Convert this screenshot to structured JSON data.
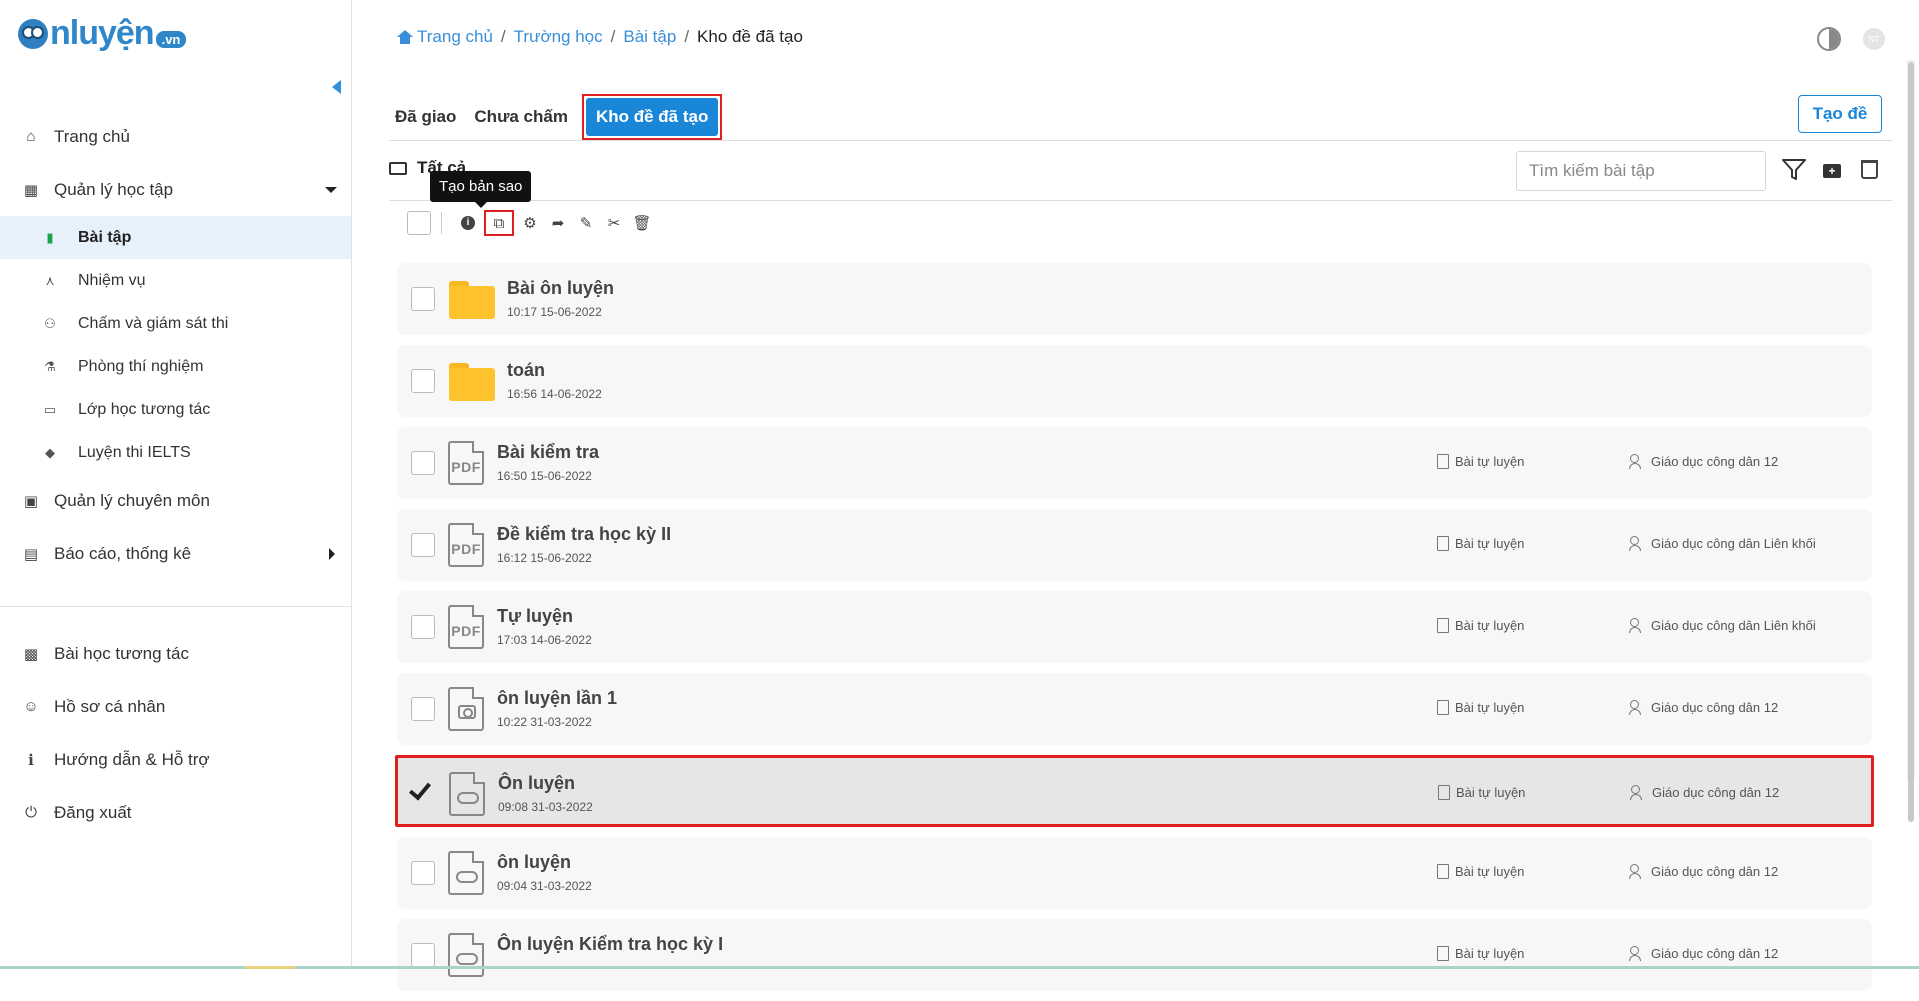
{
  "logo": {
    "text": "nluyện",
    "suffix": ".vn"
  },
  "sidebar": {
    "items": [
      {
        "label": "Trang chủ",
        "icon": "home-icon"
      },
      {
        "label": "Quản lý học tập",
        "icon": "school-icon"
      }
    ],
    "sub_items": [
      {
        "label": "Bài tập",
        "icon": "trash-bin-icon"
      },
      {
        "label": "Nhiệm vụ",
        "icon": "compass-icon"
      },
      {
        "label": "Chấm và giám sát thi",
        "icon": "people-icon"
      },
      {
        "label": "Phòng thí nghiệm",
        "icon": "flask-icon"
      },
      {
        "label": "Lớp học tương tác",
        "icon": "monitor-icon"
      },
      {
        "label": "Luyện thi IELTS",
        "icon": "graduation-icon"
      }
    ],
    "items2": [
      {
        "label": "Quản lý chuyên môn",
        "icon": "calendar-icon"
      },
      {
        "label": "Báo cáo, thống kê",
        "icon": "report-icon"
      }
    ],
    "bottom_items": [
      {
        "label": "Bài học tương tác",
        "icon": "lesson-icon"
      },
      {
        "label": "Hồ sơ cá nhân",
        "icon": "user-icon"
      },
      {
        "label": "Hướng dẫn & Hỗ trợ",
        "icon": "info-icon"
      },
      {
        "label": "Đăng xuất",
        "icon": "power-icon"
      }
    ]
  },
  "breadcrumb": {
    "home": "Trang chủ",
    "school": "Trường học",
    "exercises": "Bài tập",
    "current": "Kho đề đã tạo"
  },
  "header": {
    "avatar_initials": "NT"
  },
  "tabs": {
    "assigned": "Đã giao",
    "ungraded": "Chưa chấm",
    "created_bank": "Kho đề đã tạo"
  },
  "create_button": "Tạo đề",
  "folder_path": "Tất cả",
  "search": {
    "placeholder": "Tìm kiếm bài tập"
  },
  "tooltip": "Tạo bản sao",
  "rows": [
    {
      "kind": "folder",
      "title": "Bài ôn luyện",
      "date": "10:17 15-06-2022"
    },
    {
      "kind": "folder",
      "title": "toán",
      "date": "16:56 14-06-2022"
    },
    {
      "kind": "pdf",
      "title": "Bài kiểm tra",
      "date": "16:50 15-06-2022",
      "type": "Bài tự luyện",
      "subject": "Giáo dục công dân 12"
    },
    {
      "kind": "pdf",
      "title": "Đề kiểm tra học kỳ II",
      "date": "16:12 15-06-2022",
      "type": "Bài tự luyện",
      "subject": "Giáo dục công dân Liên khối"
    },
    {
      "kind": "pdf",
      "title": "Tự luyện",
      "date": "17:03 14-06-2022",
      "type": "Bài tự luyện",
      "subject": "Giáo dục công dân Liên khối"
    },
    {
      "kind": "camera",
      "title": "ôn luyện lần 1",
      "date": "10:22 31-03-2022",
      "type": "Bài tự luyện",
      "subject": "Giáo dục công dân 12"
    },
    {
      "kind": "cloud",
      "title": "Ôn luyện",
      "date": "09:08 31-03-2022",
      "type": "Bài tự luyện",
      "subject": "Giáo dục công dân 12",
      "selected": true
    },
    {
      "kind": "cloud",
      "title": "ôn luyện",
      "date": "09:04 31-03-2022",
      "type": "Bài tự luyện",
      "subject": "Giáo dục công dân 12"
    },
    {
      "kind": "cloud",
      "title": "Ôn luyện Kiểm tra học kỳ I",
      "date": "",
      "type": "Bài tự luyện",
      "subject": "Giáo dục công dân 12"
    }
  ],
  "pdf_label": "PDF",
  "colors": {
    "accent": "#1a86d8",
    "highlight": "#e02020",
    "folder": "#fec22c"
  }
}
